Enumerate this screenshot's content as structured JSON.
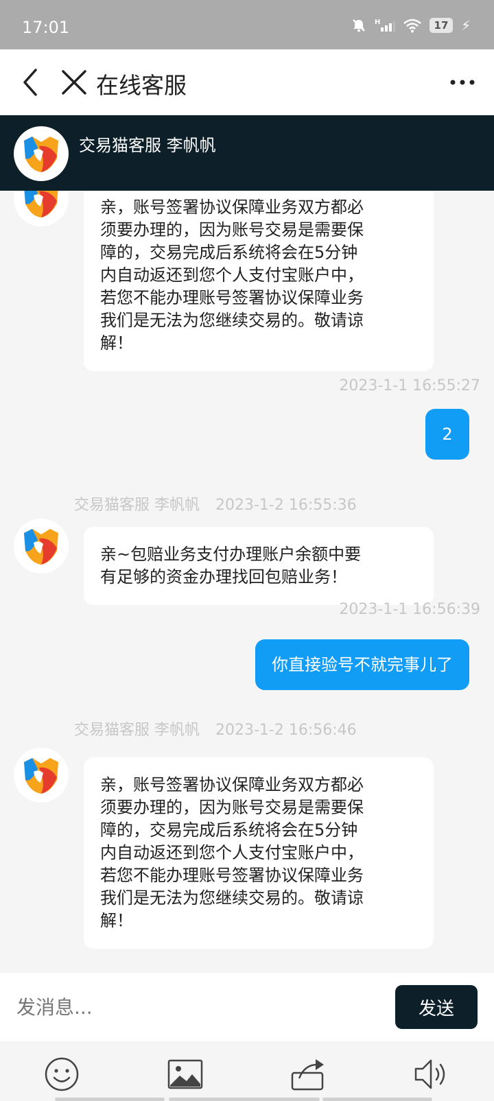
{
  "status_bar": {
    "time": "17:01",
    "battery": "17"
  },
  "nav": {
    "title": "在线客服"
  },
  "agent": {
    "name": "交易猫客服 李帆帆"
  },
  "messages": [
    {
      "from": "agent",
      "text": "亲，账号签署协议保障业务双方都必\n须要办理的，因为账号交易是需要保\n障的，交易完成后系统将会在5分钟\n内自动返还到您个人支付宝账户中，\n若您不能办理账号签署协议保障业务\n我们是无法为您继续交易的。敬请谅\n解！"
    },
    {
      "from": "user",
      "timestamp": "2023-1-1 16:55:27",
      "text": "2"
    },
    {
      "from": "agent",
      "sender": "交易猫客服 李帆帆",
      "timestamp": "2023-1-2 16:55:36",
      "text": "亲~包赔业务支付办理账户余额中要\n有足够的资金办理找回包赔业务！"
    },
    {
      "from": "user",
      "timestamp": "2023-1-1 16:56:39",
      "text": "你直接验号不就完事儿了"
    },
    {
      "from": "agent",
      "sender": "交易猫客服 李帆帆",
      "timestamp": "2023-1-2 16:56:46",
      "text": "亲，账号签署协议保障业务双方都必\n须要办理的，因为账号交易是需要保\n障的，交易完成后系统将会在5分钟\n内自动返还到您个人支付宝账户中，\n若您不能办理账号签署协议保障业务\n我们是无法为您继续交易的。敬请谅\n解！"
    }
  ],
  "input": {
    "placeholder": "发消息..."
  },
  "send_label": "发送",
  "toolbar": {
    "icons": [
      "emoji-icon",
      "image-icon",
      "transfer-icon",
      "speaker-icon"
    ]
  },
  "colors": {
    "header_bg": "#0d1f29",
    "user_bubble": "#119cf5",
    "send_button": "#0d1f29"
  }
}
